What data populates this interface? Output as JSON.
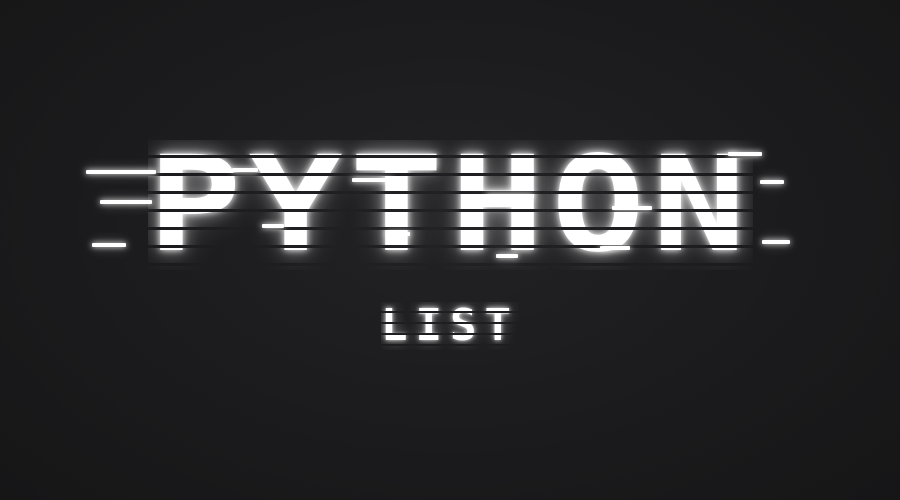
{
  "title": "PYTHON",
  "subtitle": "LIST",
  "colors": {
    "background": "#1b1b1d",
    "text": "#ffffff",
    "glow": "#ffffff"
  }
}
